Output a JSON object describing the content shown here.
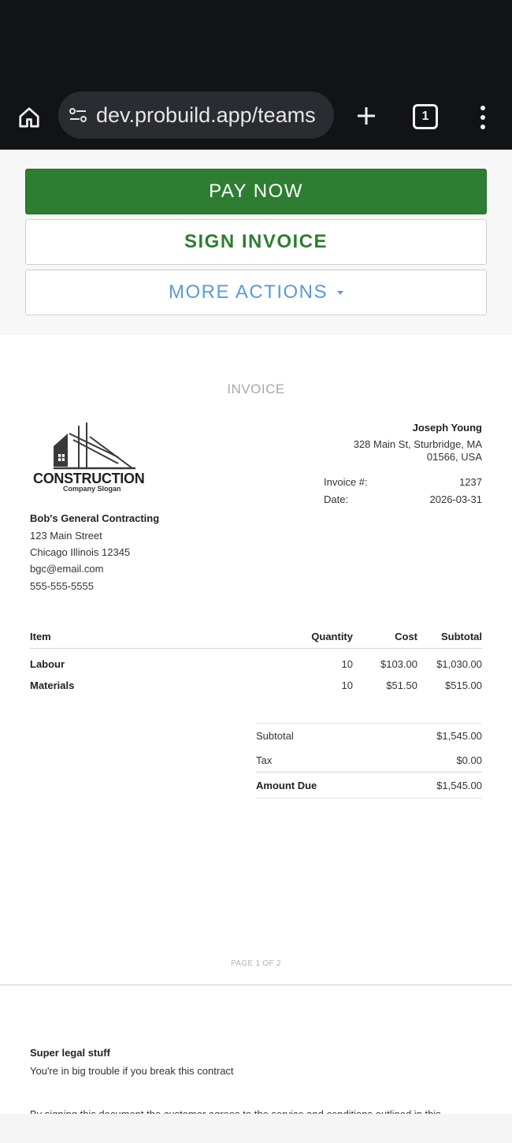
{
  "browser": {
    "url": "dev.probuild.app/teams",
    "tab_count": "1",
    "icons": {
      "home": "home-icon",
      "site_settings": "site-settings-icon",
      "new_tab": "plus-icon",
      "menu": "more-vert-icon"
    }
  },
  "actions": {
    "pay_label": "PAY NOW",
    "sign_label": "SIGN INVOICE",
    "more_label": "MORE ACTIONS"
  },
  "invoice": {
    "title": "INVOICE",
    "logo": {
      "word": "CONSTRUCTION",
      "slogan": "Company Slogan"
    },
    "client": {
      "name": "Joseph Young",
      "address_line1": "328 Main St, Sturbridge, MA",
      "address_line2": "01566, USA"
    },
    "meta": {
      "number_label": "Invoice #:",
      "number_value": "1237",
      "date_label": "Date:",
      "date_value": "2026-03-31"
    },
    "company": {
      "name": "Bob's General Contracting",
      "street": "123 Main Street",
      "city": "Chicago Illinois 12345",
      "email": "bgc@email.com",
      "phone": "555-555-5555"
    },
    "table": {
      "headers": [
        "Item",
        "Quantity",
        "Cost",
        "Subtotal"
      ],
      "rows": [
        {
          "item": "Labour",
          "qty": "10",
          "cost": "$103.00",
          "subtotal": "$1,030.00"
        },
        {
          "item": "Materials",
          "qty": "10",
          "cost": "$51.50",
          "subtotal": "$515.00"
        }
      ]
    },
    "totals": {
      "subtotal_label": "Subtotal",
      "subtotal_value": "$1,545.00",
      "tax_label": "Tax",
      "tax_value": "$0.00",
      "due_label": "Amount Due",
      "due_value": "$1,545.00"
    },
    "page_label": "PAGE 1 OF 2"
  },
  "legal": {
    "title": "Super legal stuff",
    "line1": "You're in big trouble if you break this contract",
    "line2": "By signing this document the customer agrees to the service and conditions outlined in this"
  },
  "colors": {
    "brand_green": "#2e7d32",
    "link_blue": "#5b9bd5",
    "browser_bg": "#121316"
  }
}
